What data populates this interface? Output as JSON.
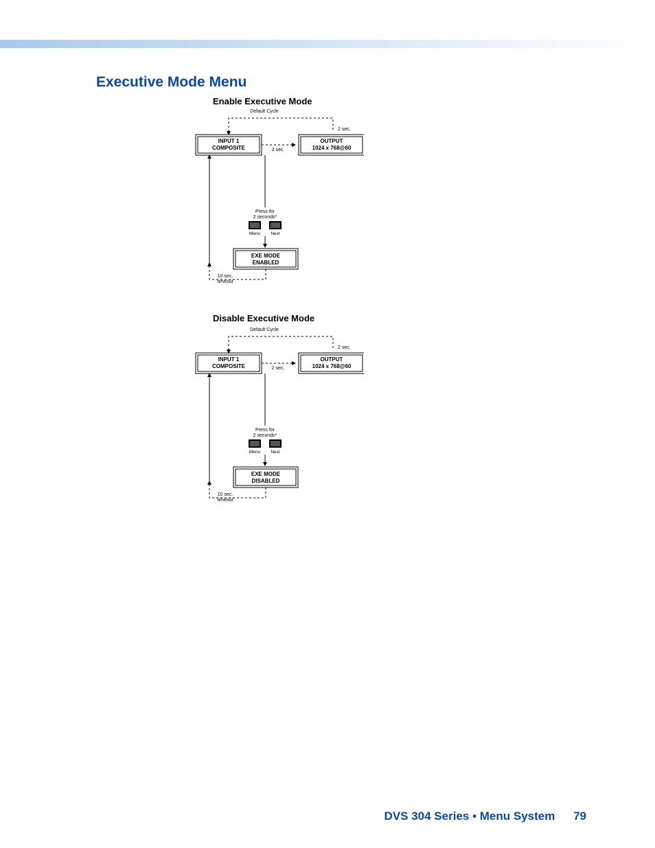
{
  "heading": "Executive Mode Menu",
  "enable": {
    "title": "Enable Executive Mode",
    "defaultCycle": "Default Cycle",
    "twoSecA": "2 sec.",
    "twoSecB": "2 sec.",
    "input": {
      "l1": "INPUT 1",
      "l2": "COMPOSITE"
    },
    "output": {
      "l1": "OUTPUT",
      "l2": "1024 x 768@60"
    },
    "press": {
      "l1": "Press for",
      "l2": "2 seconds*"
    },
    "btnMenu": "Menu",
    "btnNext": "Next",
    "exe": {
      "l1": "EXE MODE",
      "l2": "ENABLED"
    },
    "timeout": {
      "l1": "10 sec.",
      "l2": "timeout"
    }
  },
  "disable": {
    "title": "Disable Executive Mode",
    "defaultCycle": "Default Cycle",
    "twoSecA": "2 sec.",
    "twoSecB": "2 sec.",
    "input": {
      "l1": "INPUT 1",
      "l2": "COMPOSITE"
    },
    "output": {
      "l1": "OUTPUT",
      "l2": "1024 x 768@60"
    },
    "press": {
      "l1": "Press for",
      "l2": "2 seconds*"
    },
    "btnMenu": "Menu",
    "btnNext": "Next",
    "exe": {
      "l1": "EXE MODE",
      "l2": "DISABLED"
    },
    "timeout": {
      "l1": "10 sec.",
      "l2": "timeout"
    }
  },
  "footer": {
    "title": "DVS 304 Series • Menu System",
    "page": "79"
  }
}
